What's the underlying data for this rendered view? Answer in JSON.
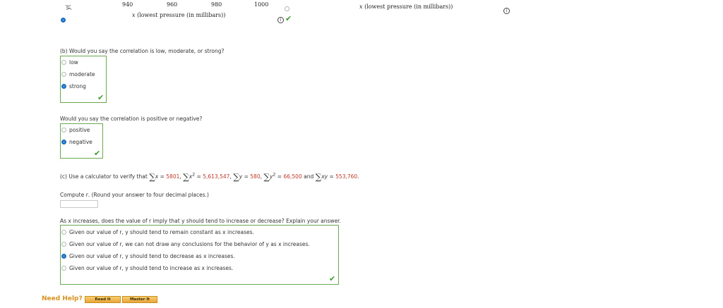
{
  "plot_left": {
    "y_axis_fragment": "y(",
    "x_ticks": [
      "940",
      "960",
      "980",
      "1000"
    ],
    "x_label_var": "x",
    "x_label_text": "(lowest pressure (in millibars))"
  },
  "plot_right": {
    "x_label_var": "x",
    "x_label_text": "(lowest pressure (in millibars))"
  },
  "part_b": {
    "question": "(b) Would you say the correlation is low, moderate, or strong?",
    "options": [
      "low",
      "moderate",
      "strong"
    ],
    "selected": 2,
    "question2": "Would you say the correlation is positive or negative?",
    "options2": [
      "positive",
      "negative"
    ],
    "selected2": 1
  },
  "part_c": {
    "prefix": "(c) Use a calculator to verify that",
    "sum_x": "5801",
    "sum_x2": "5,613,547",
    "sum_y": "580",
    "sum_y2": "66,500",
    "sum_xy": "553,760",
    "and_word": "and",
    "compute_prefix": "Compute",
    "compute_var": "r",
    "compute_suffix": ". (Round your answer to four decimal places.)",
    "answer_value": "",
    "as_q": "As x increases, does the value of r imply that y should tend to increase or decrease? Explain your answer.",
    "options": [
      "Given our value of r, y should tend to remain constant as x increases.",
      "Given our value of r, we can not draw any conclusions for the behavior of y as x increases.",
      "Given our value of r, y should tend to decrease as x increases.",
      "Given our value of r, y should tend to increase as x increases."
    ],
    "selected": 2
  },
  "help": {
    "label": "Need Help?",
    "read_it": "Read It",
    "master_it": "Master It"
  },
  "colors": {
    "correct_border": "#6aa84f",
    "check_green": "#3b9b2b",
    "selected_blue": "#1c6fc2",
    "value_red": "#c0392b",
    "help_orange": "#d6931f"
  }
}
